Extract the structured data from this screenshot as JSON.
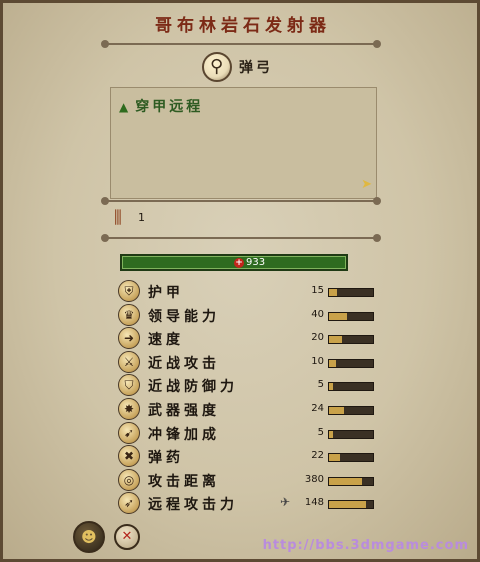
{
  "title": "哥布林岩石发射器",
  "subtitle": "弹弓",
  "ability": {
    "label": "穿甲远程"
  },
  "ammo": {
    "value": "1"
  },
  "hp": {
    "value": "933"
  },
  "stats": [
    {
      "label": "护甲",
      "value": "15",
      "icon": "armor-icon",
      "fill": 0.18
    },
    {
      "label": "领导能力",
      "value": "40",
      "icon": "leadership-icon",
      "fill": 0.4
    },
    {
      "label": "速度",
      "value": "20",
      "icon": "speed-icon",
      "fill": 0.3
    },
    {
      "label": "近战攻击",
      "value": "10",
      "icon": "melee-attack-icon",
      "fill": 0.15
    },
    {
      "label": "近战防御力",
      "value": "5",
      "icon": "melee-defense-icon",
      "fill": 0.08
    },
    {
      "label": "武器强度",
      "value": "24",
      "icon": "weapon-strength-icon",
      "fill": 0.35
    },
    {
      "label": "冲锋加成",
      "value": "5",
      "icon": "charge-bonus-icon",
      "fill": 0.08
    },
    {
      "label": "弹药",
      "value": "22",
      "icon": "ammunition-icon",
      "fill": 0.25
    },
    {
      "label": "攻击距离",
      "value": "380",
      "icon": "range-icon",
      "fill": 0.75
    },
    {
      "label": "远程攻击力",
      "value": "148",
      "icon": "missile-strength-icon",
      "fill": 0.85
    }
  ],
  "watermark": "http://bbs.3dmgame.com"
}
